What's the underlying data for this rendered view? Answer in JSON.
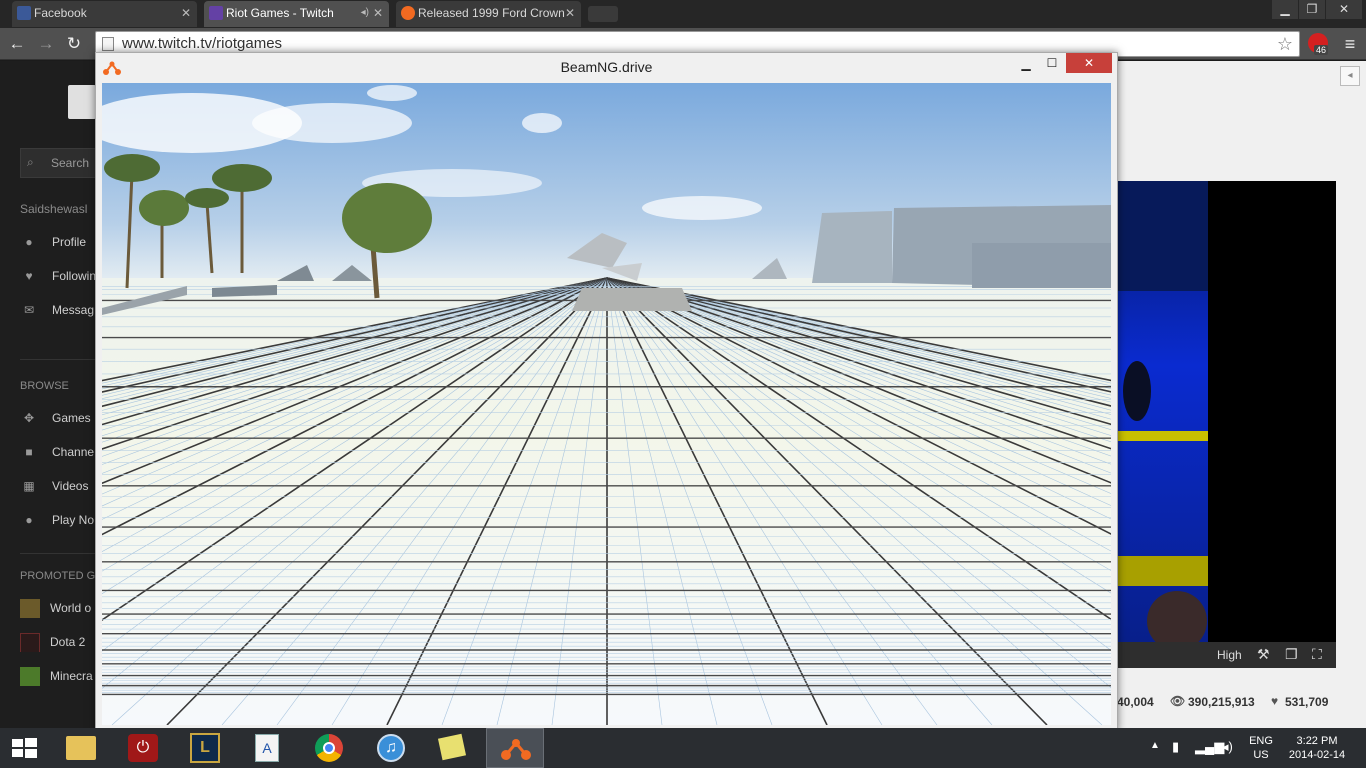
{
  "tabs": [
    {
      "title": "Facebook",
      "active": false,
      "color": "#3b5998"
    },
    {
      "title": "Riot Games - Twitch",
      "active": true,
      "color": "#6441a5"
    },
    {
      "title": "Released 1999 Ford Crown",
      "active": false,
      "color": "#f26a21"
    }
  ],
  "toolbar": {
    "url": "www.twitch.tv/riotgames",
    "extension_badge": "46"
  },
  "sidebar": {
    "search_placeholder": "Search",
    "username": "Saidshewasl",
    "user_items": [
      {
        "label": "Profile",
        "icon": "person-icon"
      },
      {
        "label": "Followin",
        "icon": "heart-icon"
      },
      {
        "label": "Messag",
        "icon": "envelope-icon"
      }
    ],
    "browse_heading": "BROWSE",
    "browse_items": [
      {
        "label": "Games",
        "icon": "gamepad-icon"
      },
      {
        "label": "Channe",
        "icon": "camera-icon"
      },
      {
        "label": "Videos",
        "icon": "grid-icon"
      },
      {
        "label": "Play No",
        "icon": "bag-icon"
      }
    ],
    "promoted_heading": "PROMOTED GA",
    "promoted_items": [
      {
        "label": "World o",
        "color": "#6b5a2a"
      },
      {
        "label": "Dota 2",
        "color": "#2a1a1a"
      },
      {
        "label": "Minecra",
        "color": "#4c7a2a"
      }
    ]
  },
  "stream": {
    "quality": "High",
    "stat_partial": "40,004",
    "views": "390,215,913",
    "followers": "531,709"
  },
  "beam_window": {
    "title": "BeamNG.drive"
  },
  "taskbar": {
    "lang_top": "ENG",
    "lang_bottom": "US",
    "time": "3:22 PM",
    "date": "2014-02-14",
    "apps": [
      "file-explorer-icon",
      "power-app-icon",
      "league-of-legends-icon",
      "notepad-icon",
      "chrome-icon",
      "itunes-icon",
      "sticky-notes-icon",
      "beamng-icon"
    ]
  }
}
